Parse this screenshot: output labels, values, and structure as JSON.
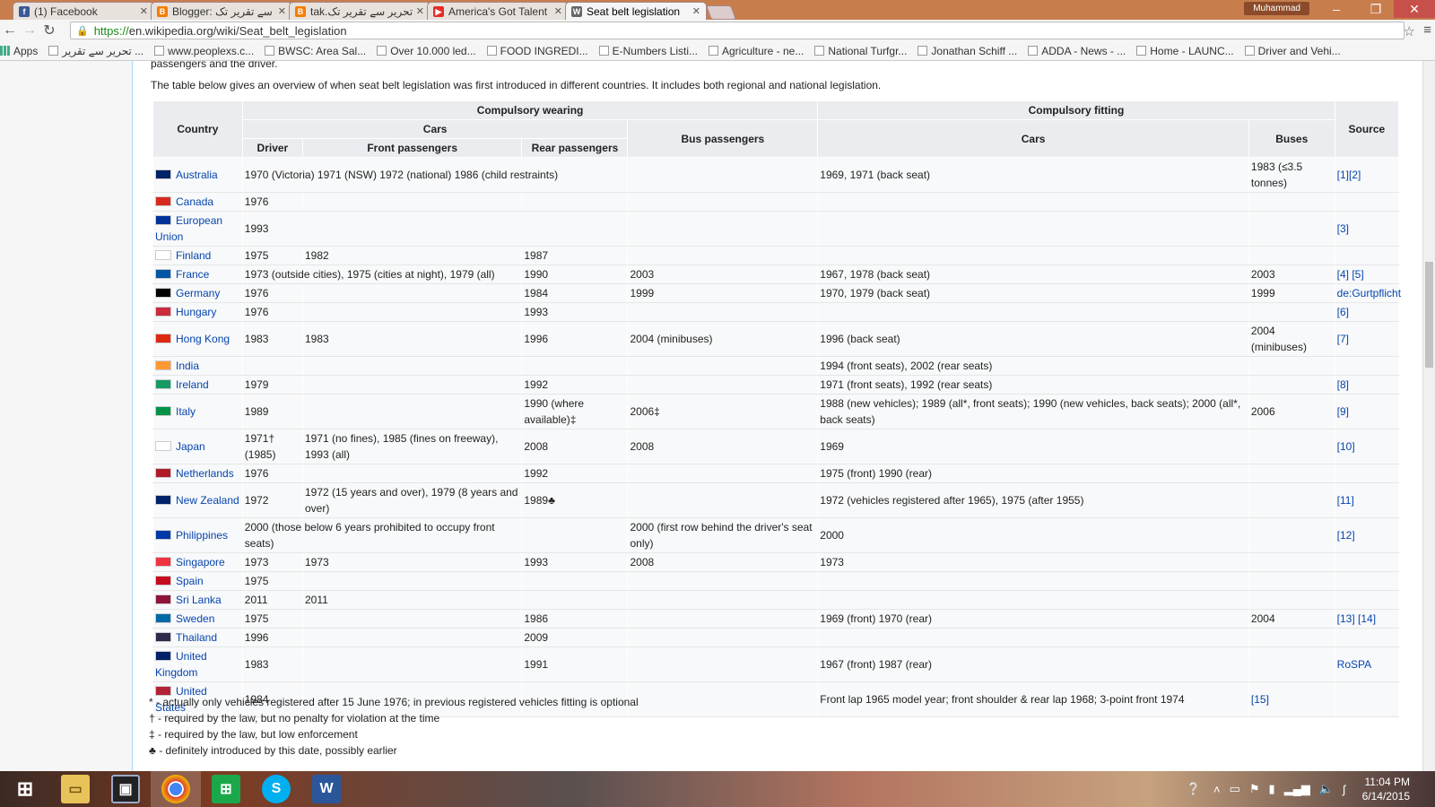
{
  "browser": {
    "tabs": [
      {
        "title": "(1) Facebook",
        "icon": "facebook-icon",
        "color": "#3b5998",
        "glyph": "f"
      },
      {
        "title": "Blogger: تحریر سے تقریر تک",
        "icon": "blogger-icon",
        "color": "#f57d00",
        "glyph": "B"
      },
      {
        "title": "tak.تحریر سے تقریر تک",
        "icon": "blogger-icon",
        "color": "#f57d00",
        "glyph": "B"
      },
      {
        "title": "America's Got Talent",
        "icon": "youtube-icon",
        "color": "#e52d27",
        "glyph": "▶"
      },
      {
        "title": "Seat belt legislation",
        "icon": "wikipedia-icon",
        "color": "#666666",
        "glyph": "W"
      }
    ],
    "profile": "Muhammad",
    "url_https": "https://",
    "url_rest": "en.wikipedia.org/wiki/Seat_belt_legislation",
    "bookmarks": [
      {
        "label": "Apps"
      },
      {
        "label": "تحریر سے تقریر ..."
      },
      {
        "label": "www.peoplexs.c..."
      },
      {
        "label": "BWSC: Area Sal..."
      },
      {
        "label": "Over 10.000 led..."
      },
      {
        "label": "FOOD INGREDI..."
      },
      {
        "label": "E-Numbers Listi..."
      },
      {
        "label": "Agriculture - ne..."
      },
      {
        "label": "National Turfgr..."
      },
      {
        "label": "Jonathan Schiff ..."
      },
      {
        "label": "ADDA - News - ..."
      },
      {
        "label": "Home - LAUNC..."
      },
      {
        "label": "Driver and Vehi..."
      }
    ]
  },
  "article": {
    "intro_cut": "passengers and the driver.",
    "intro": "The table below gives an overview of when seat belt legislation was first introduced in different countries. It includes both regional and national legislation.",
    "headers": {
      "country": "Country",
      "compulsory_wearing": "Compulsory wearing",
      "compulsory_fitting": "Compulsory fitting",
      "cars": "Cars",
      "driver": "Driver",
      "front": "Front passengers",
      "rear": "Rear passengers",
      "bus": "Bus passengers",
      "fit_cars": "Cars",
      "buses": "Buses",
      "source": "Source"
    },
    "rows": [
      {
        "country": "Australia",
        "flag": "#012169",
        "driver": "1970 (Victoria) 1971 (NSW) 1972 (national) 1986 (child restraints)",
        "front": "",
        "rear": "",
        "bus": "",
        "fit": "1969, 1971 (back seat)",
        "buses": "1983 (≤3.5 tonnes)",
        "source": "[1][2]",
        "span": true
      },
      {
        "country": "Canada",
        "flag": "#d52b1e",
        "driver": "1976",
        "front": "",
        "rear": "",
        "bus": "",
        "fit": "",
        "buses": "",
        "source": ""
      },
      {
        "country": "European Union",
        "flag": "#003399",
        "driver": "1993",
        "front": "",
        "rear": "",
        "bus": "",
        "fit": "",
        "buses": "",
        "source": "[3]",
        "span": true
      },
      {
        "country": "Finland",
        "flag": "#ffffff",
        "driver": "1975",
        "front": "1982",
        "rear": "1987",
        "bus": "",
        "fit": "",
        "buses": "",
        "source": ""
      },
      {
        "country": "France",
        "flag": "#0055a4",
        "driver": "1973 (outside cities), 1975 (cities at night), 1979 (all)",
        "front": "",
        "rear": "1990",
        "bus": "2003",
        "fit": "1967, 1978 (back seat)",
        "buses": "2003",
        "source": "[4] [5]",
        "span": "front"
      },
      {
        "country": "Germany",
        "flag": "#000000",
        "driver": "1976",
        "front": "",
        "rear": "1984",
        "bus": "1999",
        "fit": "1970, 1979 (back seat)",
        "buses": "1999",
        "source": "de:Gurtpflicht"
      },
      {
        "country": "Hungary",
        "flag": "#cd2a3e",
        "driver": "1976",
        "front": "",
        "rear": "1993",
        "bus": "",
        "fit": "",
        "buses": "",
        "source": "[6]"
      },
      {
        "country": "Hong Kong",
        "flag": "#de2910",
        "driver": "1983",
        "front": "1983",
        "rear": "1996",
        "bus": "2004 (minibuses)",
        "fit": "1996 (back seat)",
        "buses": "2004 (minibuses)",
        "source": "[7]"
      },
      {
        "country": "India",
        "flag": "#ff9933",
        "driver": "",
        "front": "",
        "rear": "",
        "bus": "",
        "fit": "1994 (front seats), 2002 (rear seats)",
        "buses": "",
        "source": ""
      },
      {
        "country": "Ireland",
        "flag": "#169b62",
        "driver": "1979",
        "front": "",
        "rear": "1992",
        "bus": "",
        "fit": "1971 (front seats), 1992 (rear seats)",
        "buses": "",
        "source": "[8]"
      },
      {
        "country": "Italy",
        "flag": "#009246",
        "driver": "1989",
        "front": "",
        "rear": "1990 (where available)‡",
        "bus": "2006‡",
        "fit": "1988 (new vehicles); 1989 (all*, front seats); 1990 (new vehicles, back seats); 2000 (all*, back seats)",
        "buses": "2006",
        "source": "[9]"
      },
      {
        "country": "Japan",
        "flag": "#ffffff",
        "driver": "1971† (1985)",
        "front": "1971 (no fines), 1985 (fines on freeway), 1993 (all)",
        "rear": "2008",
        "bus": "2008",
        "fit": "1969",
        "buses": "",
        "source": "[10]"
      },
      {
        "country": "Netherlands",
        "flag": "#ae1c28",
        "driver": "1976",
        "front": "",
        "rear": "1992",
        "bus": "",
        "fit": "1975 (front) 1990 (rear)",
        "buses": "",
        "source": ""
      },
      {
        "country": "New Zealand",
        "flag": "#012169",
        "driver": "1972",
        "front": "1972 (15 years and over), 1979 (8 years and over)",
        "rear": "1989♣",
        "bus": "",
        "fit": "1972 (vehicles registered after 1965), 1975 (after 1955)",
        "buses": "",
        "source": "[11]"
      },
      {
        "country": "Philippines",
        "flag": "#0038a8",
        "driver": "2000 (those below 6 years prohibited to occupy front seats)",
        "front": "",
        "rear": "",
        "bus": "2000 (first row behind the driver's seat only)",
        "fit": "2000",
        "buses": "",
        "source": "[12]",
        "span": "front"
      },
      {
        "country": "Singapore",
        "flag": "#ef3340",
        "driver": "1973",
        "front": "1973",
        "rear": "1993",
        "bus": "2008",
        "fit": "1973",
        "buses": "",
        "source": ""
      },
      {
        "country": "Spain",
        "flag": "#c60b1e",
        "driver": "1975",
        "front": "",
        "rear": "",
        "bus": "",
        "fit": "",
        "buses": "",
        "source": ""
      },
      {
        "country": "Sri Lanka",
        "flag": "#8d153a",
        "driver": "2011",
        "front": "2011",
        "rear": "",
        "bus": "",
        "fit": "",
        "buses": "",
        "source": ""
      },
      {
        "country": "Sweden",
        "flag": "#006aa7",
        "driver": "1975",
        "front": "",
        "rear": "1986",
        "bus": "",
        "fit": "1969 (front) 1970 (rear)",
        "buses": "2004",
        "source": "[13] [14]"
      },
      {
        "country": "Thailand",
        "flag": "#2d2a4a",
        "driver": "1996",
        "front": "",
        "rear": "2009",
        "bus": "",
        "fit": "",
        "buses": "",
        "source": ""
      },
      {
        "country": "United Kingdom",
        "flag": "#012169",
        "driver": "1983",
        "front": "",
        "rear": "1991",
        "bus": "",
        "fit": "1967 (front) 1987 (rear)",
        "buses": "",
        "source": "RoSPA"
      },
      {
        "country": "United States",
        "flag": "#b22234",
        "driver": "1984",
        "front": "",
        "rear": "",
        "bus": "",
        "fit": "Front lap 1965 model year; front shoulder & rear lap 1968; 3-point front 1974",
        "buses": "[15]",
        "source": ""
      }
    ],
    "notes": [
      "* - actually only vehicles registered after 15 June 1976; in previous registered vehicles fitting is optional",
      "† - required by the law, but no penalty for violation at the time",
      "‡ - required by the law, but low enforcement",
      "♣ - definitely introduced by this date, possibly earlier"
    ]
  },
  "taskbar": {
    "clock_time": "11:04 PM",
    "clock_date": "6/14/2015"
  }
}
